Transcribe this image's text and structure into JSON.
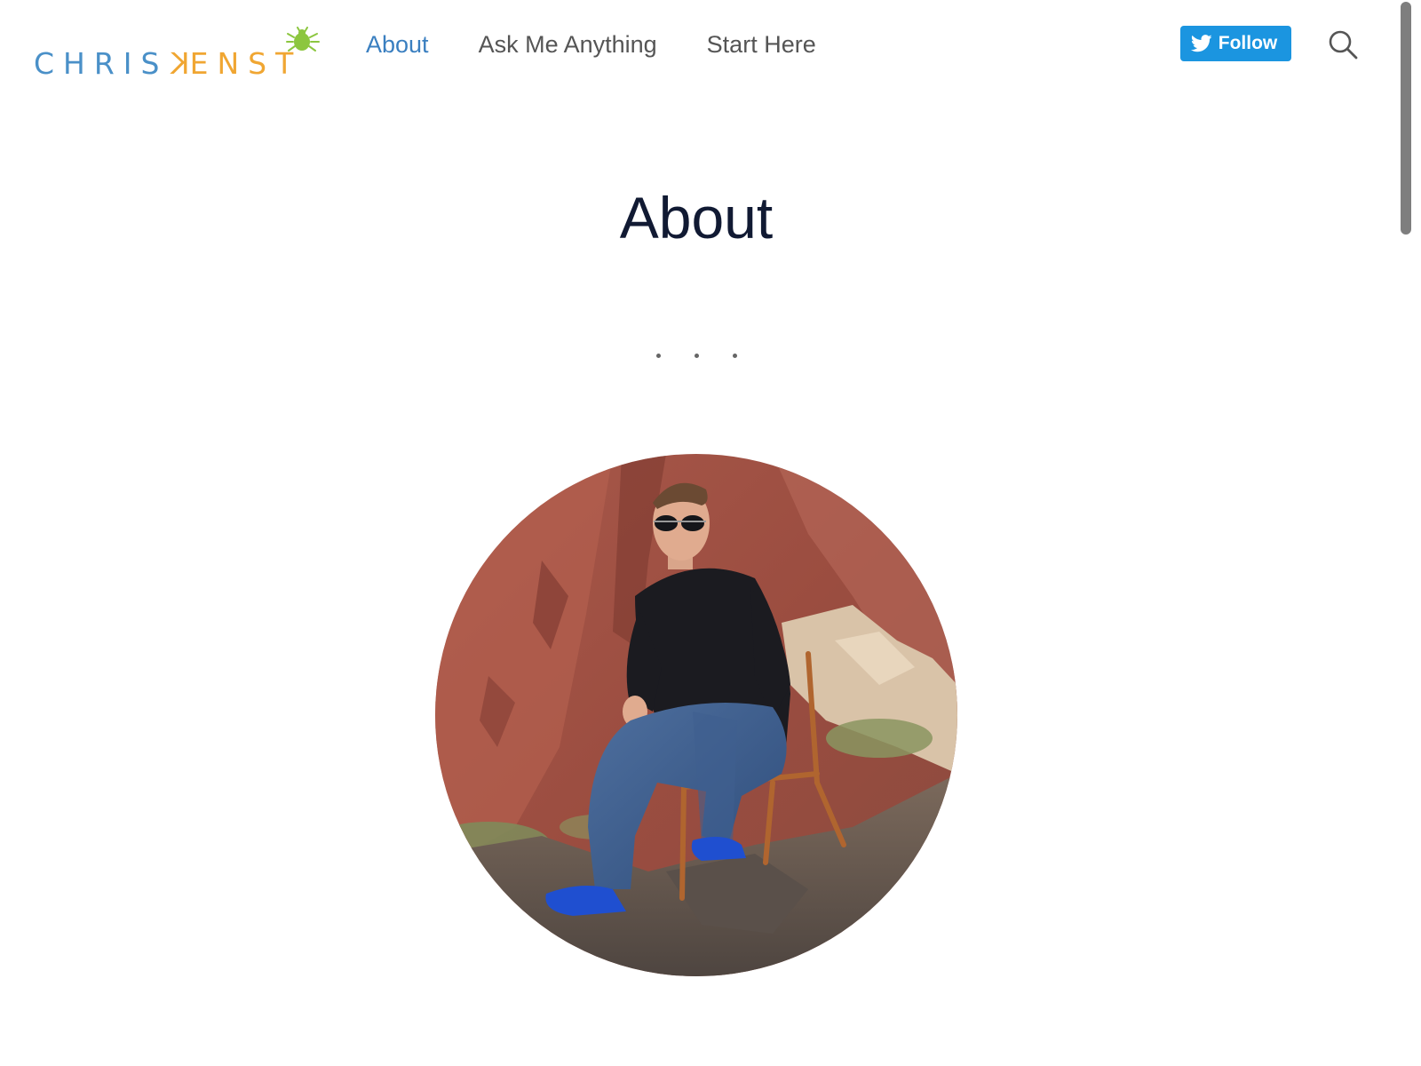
{
  "header": {
    "logo": {
      "first": "CHRIS",
      "last_k": "K",
      "last_rest": "ENST",
      "bug_icon": "bug-icon",
      "colors": {
        "first": "#4a90c8",
        "last": "#f0a632",
        "bug": "#8cc63f"
      }
    },
    "nav": [
      {
        "label": "About",
        "active": true
      },
      {
        "label": "Ask Me Anything",
        "active": false
      },
      {
        "label": "Start Here",
        "active": false
      }
    ],
    "follow_button": {
      "label": "Follow",
      "icon": "twitter-icon",
      "color": "#1b95e0"
    },
    "search": {
      "icon": "search-icon"
    }
  },
  "main": {
    "title": "About",
    "separator_dots": 3,
    "portrait": {
      "icon": "portrait-photo",
      "shape": "circle"
    }
  },
  "colors": {
    "nav_active": "#3a7fc0",
    "nav_text": "#555555",
    "title": "#111a33"
  }
}
